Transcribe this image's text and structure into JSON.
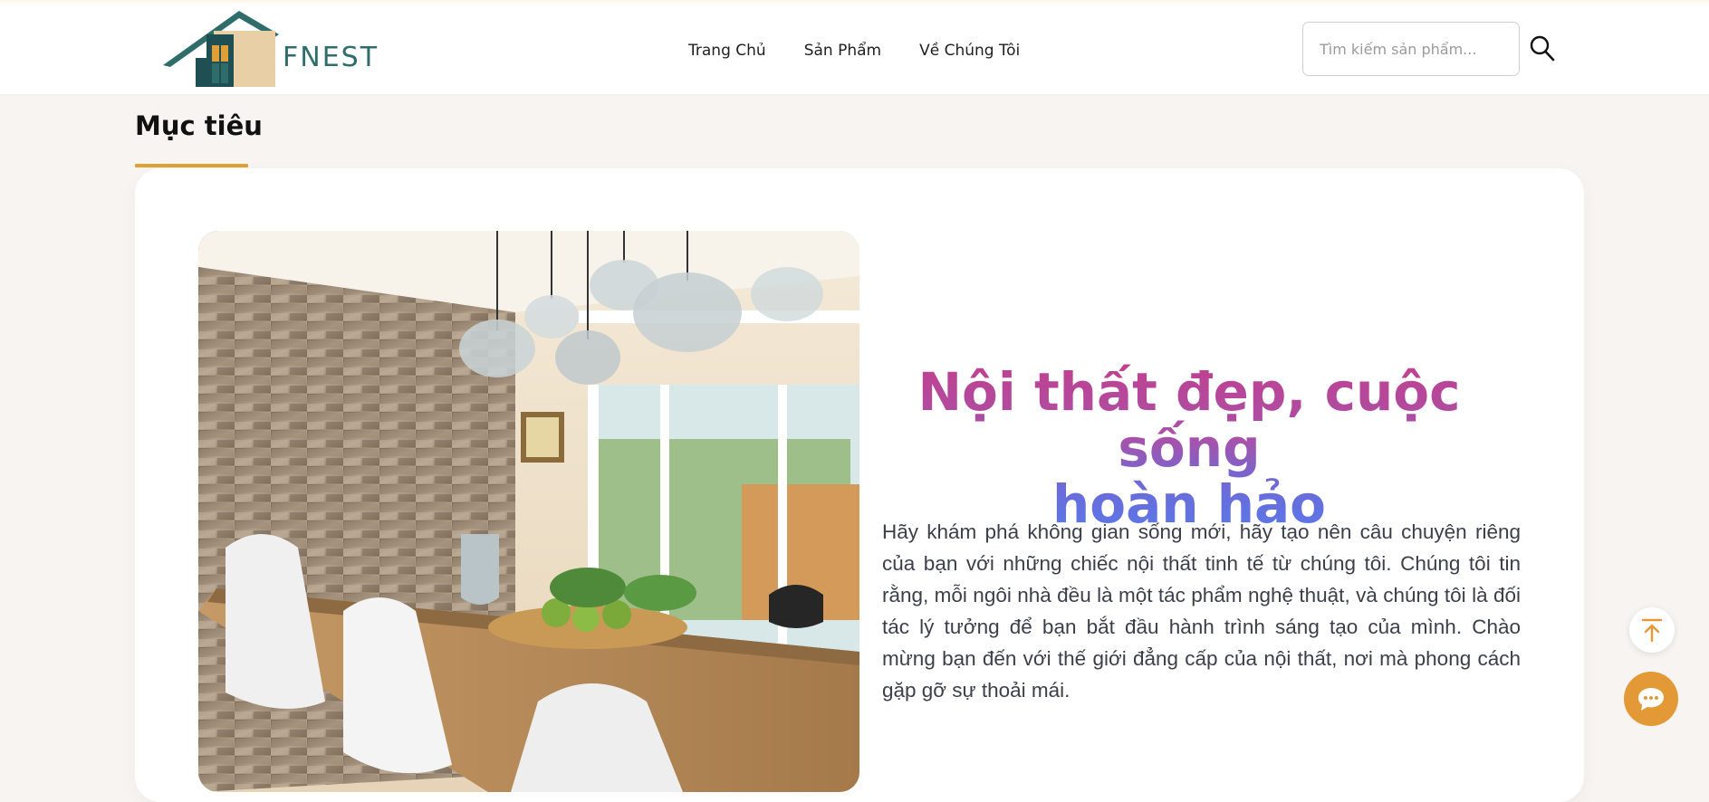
{
  "header": {
    "logo_text": "FNEST",
    "nav": [
      {
        "label": "Trang Chủ"
      },
      {
        "label": "Sản Phẩm"
      },
      {
        "label": "Về Chúng Tôi"
      }
    ],
    "search": {
      "placeholder": "Tìm kiếm sản phẩm..."
    }
  },
  "section": {
    "title": "Mục tiêu"
  },
  "hero": {
    "headline_line1": "Nội thất đẹp, cuộc sống",
    "headline_line2": "hoàn hảo",
    "description": "Hãy khám phá không gian sống mới, hãy tạo nên câu chuyện riêng của bạn với những chiếc nội thất tinh tế từ chúng tôi. Chúng tôi tin rằng, mỗi ngôi nhà đều là một tác phẩm nghệ thuật, và chúng tôi là đối tác lý tưởng để bạn bắt đầu hành trình sáng tạo của mình. Chào mừng bạn đến với thế giới đẳng cấp của nội thất, nơi mà phong cách gặp gỡ sự thoải mái."
  },
  "floating": {
    "to_top_icon": "arrow-up-to-line-icon",
    "chat_icon": "chat-bubble-icon"
  },
  "colors": {
    "accent": "#e0a037",
    "chat_button": "#e39a36",
    "logo_teal": "#2f6d6b",
    "headline_pink": "#c0408f",
    "headline_blue": "#5b78e8",
    "page_background": "#f8f4f1"
  }
}
